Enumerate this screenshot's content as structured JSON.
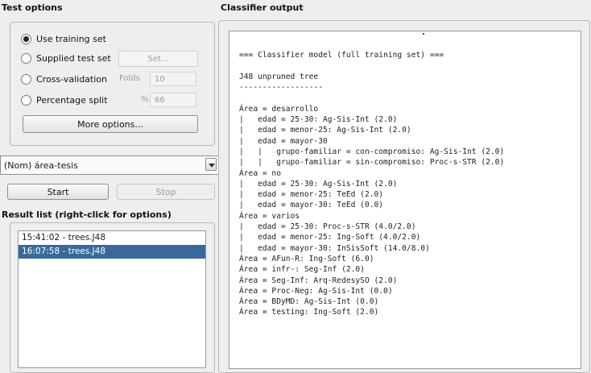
{
  "test_options": {
    "title": "Test options",
    "radios": [
      {
        "label": "Use training set",
        "selected": true
      },
      {
        "label": "Supplied test set",
        "selected": false
      },
      {
        "label": "Cross-validation",
        "selected": false
      },
      {
        "label": "Percentage split",
        "selected": false
      }
    ],
    "set_button": "Set...",
    "folds_label": "Folds",
    "folds_value": "10",
    "percent_label": "%",
    "percent_value": "66",
    "more_options_button": "More options..."
  },
  "class_attribute": {
    "selected": "(Nom) área-tesis"
  },
  "controls": {
    "start_button": "Start",
    "stop_button": "Stop"
  },
  "result_list": {
    "title": "Result list (right-click for options)",
    "items": [
      {
        "label": "15:41:02 - trees.J48",
        "selected": false
      },
      {
        "label": "16:07:58 - trees.J48",
        "selected": true
      }
    ]
  },
  "classifier_output": {
    "title": "Classifier output",
    "lines": [
      "",
      "=== Classifier model (full training set) ===",
      "",
      "J48 unpruned tree",
      "------------------",
      "",
      "Área = desarrollo",
      "|   edad = 25-30: Ag-Sis-Int (2.0)",
      "|   edad = menor-25: Ag-Sis-Int (2.0)",
      "|   edad = mayor-30",
      "|   |   grupo-familiar = con-compromiso: Ag-Sis-Int (2.0)",
      "|   |   grupo-familiar = sin-compromiso: Proc-s-STR (2.0)",
      "Área = no",
      "|   edad = 25-30: Ag-Sis-Int (2.0)",
      "|   edad = menor-25: TeEd (2.0)",
      "|   edad = mayor-30: TeEd (0.0)",
      "Área = varios",
      "|   edad = 25-30: Proc-s-STR (4.0/2.0)",
      "|   edad = menor-25: Ing-Soft (4.0/2.0)",
      "|   edad = mayor-30: InSisSoft (14.0/8.0)",
      "Área = AFun-R: Ing-Soft (6.0)",
      "Área = infr-: Seg-Inf (2.0)",
      "Área = Seg-Inf: Arq-RedesySO (2.0)",
      "Área = Proc-Neg: Ag-Sis-Int (0.0)",
      "Área = BDyMD: Ag-Sis-Int (0.0)",
      "Área = testing: Ing-Soft (2.0)"
    ]
  }
}
